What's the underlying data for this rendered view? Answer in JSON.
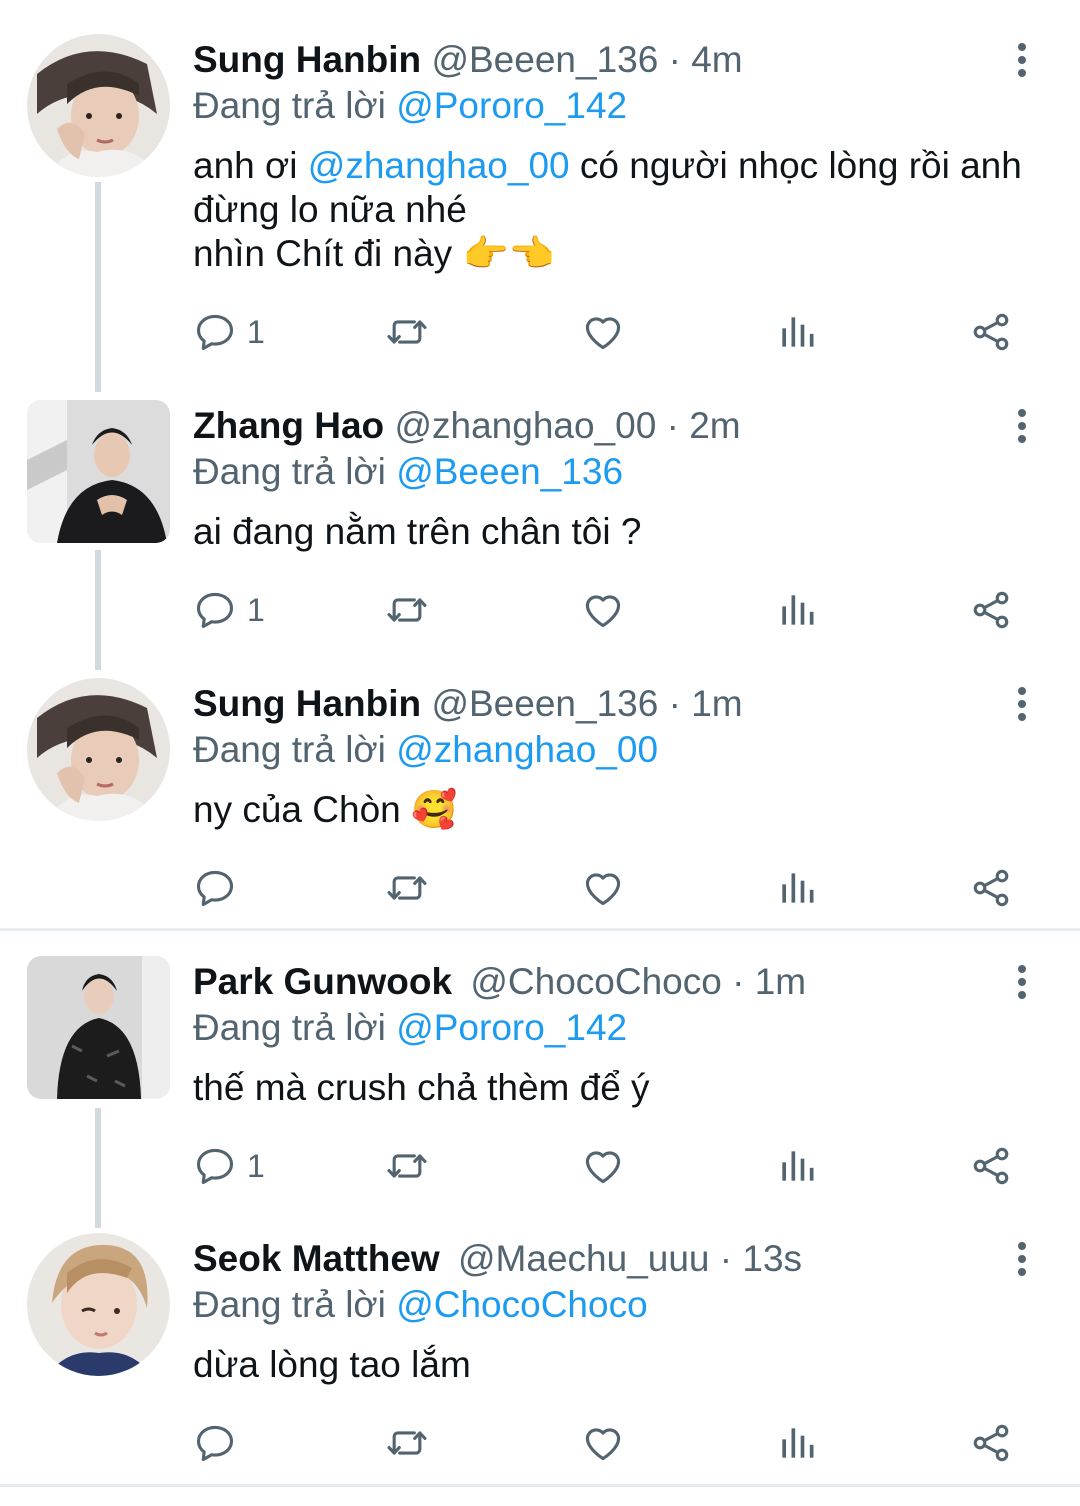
{
  "tweets": [
    {
      "name": "Sung Hanbin",
      "handle": "@Beeen_136",
      "time": "4m",
      "reply_prefix": "Đang trả lời",
      "reply_to": "@Pororo_142",
      "text_before_mention": "anh ơi ",
      "mention": "@zhanghao_00",
      "text_line1_after": " có người nhọc lòng rồi anh",
      "text_line2": "đừng lo nữa nhé",
      "text_line3": "nhìn Chít đi này",
      "emoji": "👉👈",
      "reply_count": "1",
      "avatar_icon": "user-avatar-hanbin"
    },
    {
      "name": "Zhang Hao",
      "handle": "@zhanghao_00",
      "time": "2m",
      "reply_prefix": "Đang trả lời",
      "reply_to": "@Beeen_136",
      "text": "ai đang nằm trên chân tôi ?",
      "reply_count": "1",
      "avatar_icon": "user-avatar-zhanghao"
    },
    {
      "name": "Sung Hanbin",
      "handle": "@Beeen_136",
      "time": "1m",
      "reply_prefix": "Đang trả lời",
      "reply_to": "@zhanghao_00",
      "text": "ny của Chòn",
      "emoji": "🥰",
      "reply_count": "",
      "avatar_icon": "user-avatar-hanbin"
    },
    {
      "name": "Park Gunwook",
      "handle": "@ChocoChoco",
      "time": "1m",
      "reply_prefix": "Đang trả lời",
      "reply_to": "@Pororo_142",
      "text": "thế mà crush chả thèm để ý",
      "reply_count": "1",
      "avatar_icon": "user-avatar-gunwook"
    },
    {
      "name": "Seok Matthew",
      "handle": "@Maechu_uuu",
      "time": "13s",
      "reply_prefix": "Đang trả lời",
      "reply_to": "@ChocoChoco",
      "text": "dừa lòng tao lắm",
      "reply_count": "",
      "avatar_icon": "user-avatar-matthew"
    }
  ],
  "separator": "·",
  "icons": {
    "reply": "reply-icon",
    "retweet": "retweet-icon",
    "like": "heart-icon",
    "views": "analytics-icon",
    "share": "share-icon",
    "more": "more-vertical-icon"
  },
  "colors": {
    "accent": "#1d9bf0",
    "secondary_text": "#536471",
    "thread_line": "#cfd9de",
    "divider": "#e6ecf0"
  }
}
